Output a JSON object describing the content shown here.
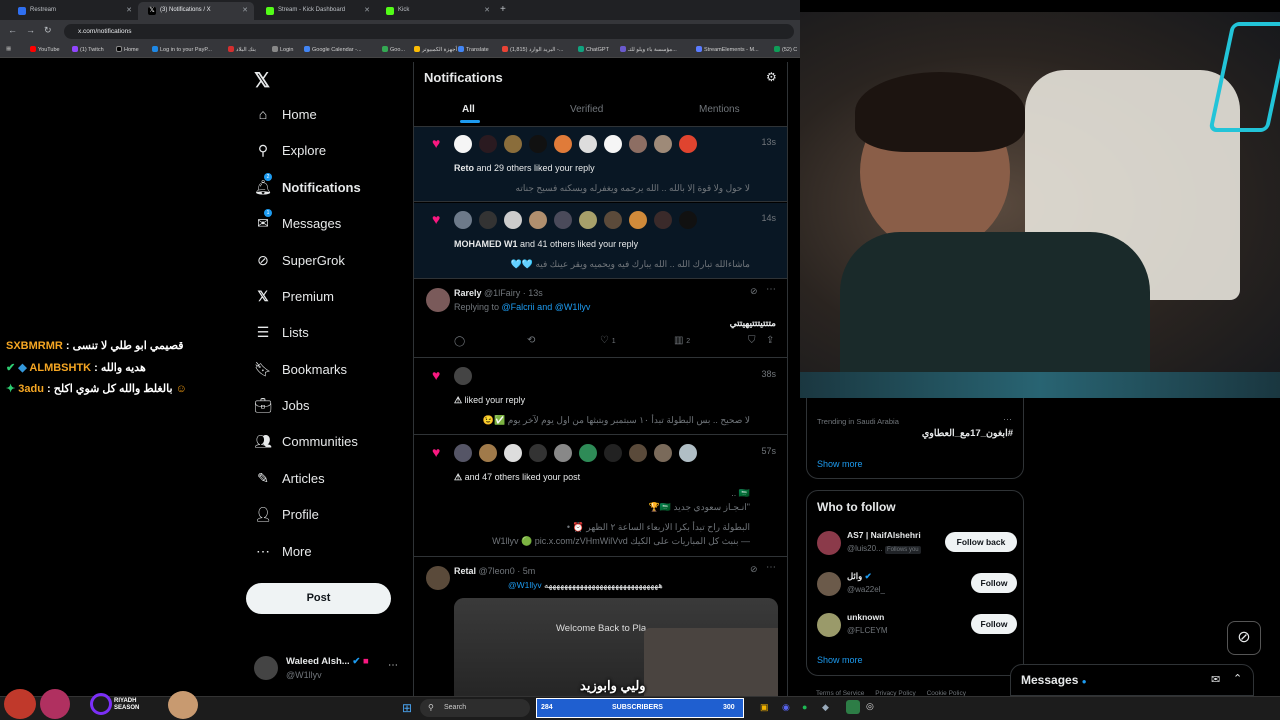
{
  "browser": {
    "tabs": [
      {
        "label": "Restream",
        "color": "#2f6ff0"
      },
      {
        "label": "(3) Notifications / X",
        "color": "#ffffff"
      },
      {
        "label": "Stream - Kick Dashboard",
        "color": "#53fc18"
      },
      {
        "label": "Kick",
        "color": "#53fc18"
      }
    ],
    "url": "x.com/notifications",
    "bookmarks": [
      "YouTube",
      "(1) Twitch",
      "Home",
      "Log in to your PayP...",
      "بنك البلاد",
      "Login",
      "Google Calendar -...",
      "Goo...",
      "أجهزة الكمبيوتر",
      "Translate",
      "(1,815) البريد الوارد -...",
      "ChatGPT",
      "مؤسسة باء ويلو للتـ...",
      "StreamElements - M...",
      "(52) C"
    ]
  },
  "chat": [
    {
      "user": "SXBMRMR",
      "text": "قصيمي ابو طلي لا تنسى"
    },
    {
      "user": "ALMBSHTK",
      "text": "هديه والله"
    },
    {
      "user": "3adu",
      "text": "بالغلط والله كل شوي اكلح"
    }
  ],
  "sidebar": {
    "items": [
      {
        "label": "Home",
        "icon": "home-icon"
      },
      {
        "label": "Explore",
        "icon": "search-icon"
      },
      {
        "label": "Notifications",
        "icon": "bell-icon",
        "badge": "2"
      },
      {
        "label": "Messages",
        "icon": "envelope-icon",
        "badge": "1"
      },
      {
        "label": "SuperGrok",
        "icon": "grok-icon"
      },
      {
        "label": "Premium",
        "icon": "x-logo-icon"
      },
      {
        "label": "Lists",
        "icon": "list-icon"
      },
      {
        "label": "Bookmarks",
        "icon": "bookmark-icon"
      },
      {
        "label": "Jobs",
        "icon": "briefcase-icon"
      },
      {
        "label": "Communities",
        "icon": "people-icon"
      },
      {
        "label": "Articles",
        "icon": "article-icon"
      },
      {
        "label": "Profile",
        "icon": "person-icon"
      },
      {
        "label": "More",
        "icon": "more-circle-icon"
      }
    ],
    "post_label": "Post",
    "account": {
      "name": "Waleed Alsh...",
      "handle": "@W1llyv"
    }
  },
  "main": {
    "title": "Notifications",
    "tabs": [
      "All",
      "Verified",
      "Mentions"
    ],
    "notifications": [
      {
        "kind": "like",
        "time": "13s",
        "actor": "Reto",
        "rest": "and 29 others liked your reply",
        "quote": "لا حول ولا قوة إلا بالله .. الله يرحمه ويغفرله ويسكنه فسيح جناته"
      },
      {
        "kind": "like",
        "time": "14s",
        "actor": "MOHAMED W1",
        "rest": "and 41 others liked your reply",
        "quote": "ماشاءالله تبارك الله .. الله يبارك فيه ويحميه ويقر عينك فيه 🩵🩵"
      },
      {
        "kind": "reply",
        "name": "Rarely",
        "handle": "@1lFairy",
        "time": "13s",
        "replying_label": "Replying to",
        "replying_to": "@Falcrii and @W1llyv",
        "text": "متتتيتتتيهيتتي",
        "likes": "1",
        "views": "2"
      },
      {
        "kind": "like",
        "time": "38s",
        "actor": "⚠",
        "rest": "liked your reply",
        "quote": "لا صحيح .. بس البطولة تبدأ ١٠ سبتمبر وبتبثها من اول يوم لآخر يوم ✅😉"
      },
      {
        "kind": "like",
        "time": "57s",
        "actor": "⚠",
        "rest": "and 47 others liked your post",
        "quote1": "🇸🇦 ..",
        "quote2": "\"انـجـاز سعودي جديد 🇸🇦🏆",
        "quote3": "البطولة راح تبدأ بكرا الاربعاء الساعة ٢ الظهر ⏰ •",
        "quote4": "— بنبث كل المباريات على الكيك W1llyv 🟢 pic.x.com/zVHmWilVvd"
      },
      {
        "kind": "reply",
        "name": "Retal",
        "handle": "@7leon0",
        "time": "5m",
        "mention": "@W1llyv",
        "text": "هههههههههههههههههههههههههههههه"
      }
    ]
  },
  "right": {
    "trending_label": "Trending in Saudi Arabia",
    "trend": "#ابغون_17مع_العطاوي",
    "show_more": "Show more",
    "who_to_follow": "Who to follow",
    "follow_items": [
      {
        "name": "AS7 | NaifAlshehri",
        "handle": "@luis20...",
        "follows_you": "Follows you",
        "button": "Follow back"
      },
      {
        "name": "وائل",
        "handle": "@wa22el_",
        "button": "Follow"
      },
      {
        "name": "unknown",
        "handle": "@FLCEYM",
        "button": "Follow"
      }
    ],
    "show_more2": "Show more",
    "footer": [
      "Terms of Service",
      "Privacy Policy",
      "Cookie Policy"
    ],
    "messages_label": "Messages"
  },
  "stream": {
    "subtitle": "وليي وابوزيد",
    "video_title": "Welcome Back to Pla",
    "subscribers_label": "SUBSCRIBERS",
    "subscribers_count": "284",
    "subscribers_goal": "300",
    "sponsor": "RIYADH SEASON"
  },
  "taskbar": {
    "search": "Search"
  }
}
